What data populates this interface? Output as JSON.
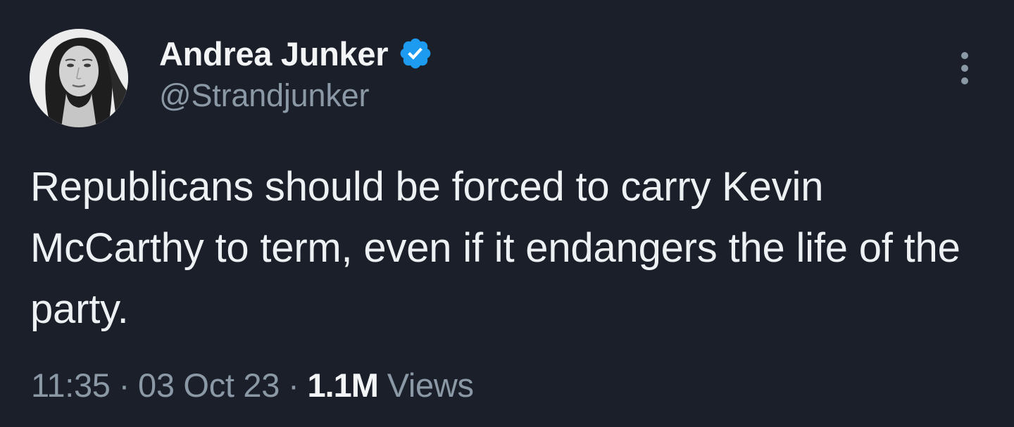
{
  "tweet": {
    "author": {
      "display_name": "Andrea Junker",
      "handle": "@Strandjunker",
      "verified": true,
      "avatar_icon": "user-avatar-photo",
      "verified_icon": "verified-badge-icon",
      "verified_color": "#1d9bf0"
    },
    "more_icon": "more-options-icon",
    "text": "Republicans should be forced to carry Kevin McCarthy to term, even if it endangers the life of the party.",
    "meta": {
      "time": "11:35",
      "separator": "·",
      "date": "03 Oct 23",
      "views_count": "1.1M",
      "views_label": "Views"
    }
  },
  "colors": {
    "background": "#1b1f2a",
    "primary_text": "#e7e9ea",
    "secondary_text": "#8b98a5",
    "accent": "#1d9bf0"
  }
}
